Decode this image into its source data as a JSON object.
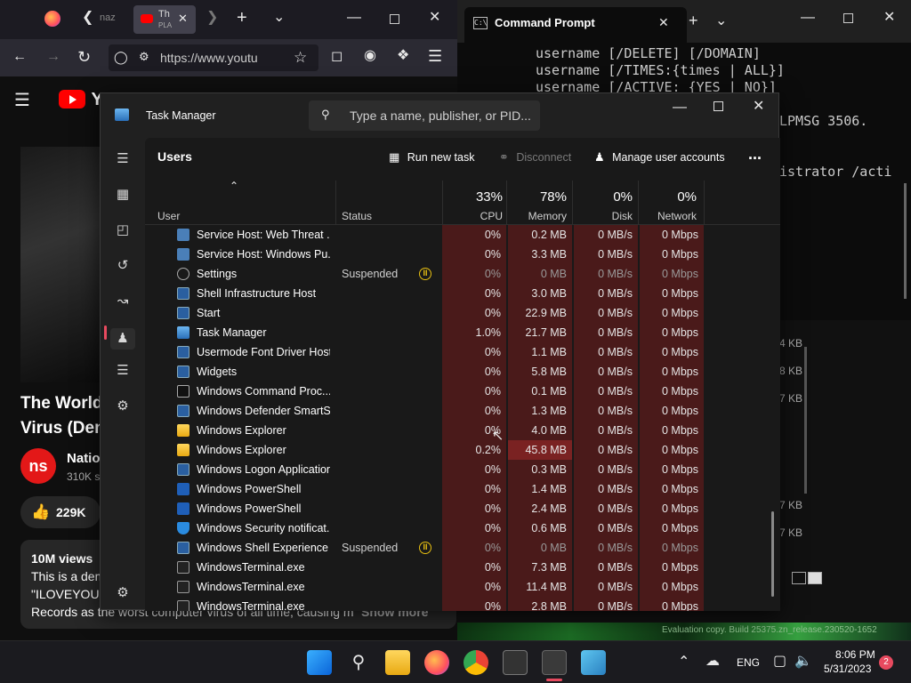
{
  "browser": {
    "tab_partial_1": "naz",
    "tab_partial_2": "Th",
    "tab_sub": "PLA",
    "url": "https://www.youtu",
    "yt_logo_partial": "Yo",
    "video_title_line1": "The World'",
    "video_title_line2": "Virus (Dem",
    "channel_partial": "Natio",
    "subs_partial": "310K s",
    "likes": "229K",
    "views": "10M views",
    "desc_line1": "This is a dem",
    "desc_line2": "\"ILOVEYOU\")",
    "desc_line3": "Records as the worst computer virus of all time, causing m",
    "show_more": "Show more"
  },
  "terminal": {
    "tab_title": "Command Prompt",
    "lines": [
      "username [/DELETE] [/DOMAIN]",
      "username [/TIMES:{times | ALL}]",
      "username [/ACTIVE: {YES | NO}]",
      "",
      "LPMSG 3506.",
      "",
      "istrator /acti"
    ]
  },
  "background_window": {
    "sizes": [
      "4 KB",
      "8 KB",
      "7 KB",
      "7 KB",
      "7 KB"
    ],
    "eval_text": "Evaluation copy. Build 25375.zn_release.230520-1652"
  },
  "taskmgr": {
    "title": "Task Manager",
    "search_placeholder": "Type a name, publisher, or PID...",
    "page_title": "Users",
    "run_new_task": "Run new task",
    "disconnect": "Disconnect",
    "manage_accounts": "Manage user accounts",
    "more": "...",
    "columns": {
      "user": "User",
      "status": "Status",
      "cpu_pct": "33%",
      "cpu": "CPU",
      "mem_pct": "78%",
      "memory": "Memory",
      "disk_pct": "0%",
      "disk": "Disk",
      "net_pct": "0%",
      "network": "Network"
    },
    "rows": [
      {
        "name": "Service Host: Web Threat ...",
        "status": "",
        "cpu": "0%",
        "mem": "0.2 MB",
        "disk": "0 MB/s",
        "net": "0 Mbps",
        "icon": "gear-box",
        "suspended": false
      },
      {
        "name": "Service Host: Windows Pu...",
        "status": "",
        "cpu": "0%",
        "mem": "3.3 MB",
        "disk": "0 MB/s",
        "net": "0 Mbps",
        "icon": "gear-box",
        "suspended": false
      },
      {
        "name": "Settings",
        "status": "Suspended",
        "cpu": "0%",
        "mem": "0 MB",
        "disk": "0 MB/s",
        "net": "0 Mbps",
        "icon": "gear",
        "suspended": true
      },
      {
        "name": "Shell Infrastructure Host",
        "status": "",
        "cpu": "0%",
        "mem": "3.0 MB",
        "disk": "0 MB/s",
        "net": "0 Mbps",
        "icon": "window",
        "suspended": false
      },
      {
        "name": "Start",
        "status": "",
        "cpu": "0%",
        "mem": "22.9 MB",
        "disk": "0 MB/s",
        "net": "0 Mbps",
        "icon": "window",
        "suspended": false
      },
      {
        "name": "Task Manager",
        "status": "",
        "cpu": "1.0%",
        "mem": "21.7 MB",
        "disk": "0 MB/s",
        "net": "0 Mbps",
        "icon": "taskmgr",
        "suspended": false
      },
      {
        "name": "Usermode Font Driver Host",
        "status": "",
        "cpu": "0%",
        "mem": "1.1 MB",
        "disk": "0 MB/s",
        "net": "0 Mbps",
        "icon": "window",
        "suspended": false
      },
      {
        "name": "Widgets",
        "status": "",
        "cpu": "0%",
        "mem": "5.8 MB",
        "disk": "0 MB/s",
        "net": "0 Mbps",
        "icon": "window",
        "suspended": false
      },
      {
        "name": "Windows Command Proc...",
        "status": "",
        "cpu": "0%",
        "mem": "0.1 MB",
        "disk": "0 MB/s",
        "net": "0 Mbps",
        "icon": "cmd",
        "suspended": false
      },
      {
        "name": "Windows Defender SmartS...",
        "status": "",
        "cpu": "0%",
        "mem": "1.3 MB",
        "disk": "0 MB/s",
        "net": "0 Mbps",
        "icon": "window",
        "suspended": false
      },
      {
        "name": "Windows Explorer",
        "status": "",
        "cpu": "0%",
        "mem": "4.0 MB",
        "disk": "0 MB/s",
        "net": "0 Mbps",
        "icon": "folder",
        "suspended": false
      },
      {
        "name": "Windows Explorer",
        "status": "",
        "cpu": "0.2%",
        "mem": "45.8 MB",
        "disk": "0 MB/s",
        "net": "0 Mbps",
        "icon": "folder",
        "suspended": false,
        "hot_mem": true
      },
      {
        "name": "Windows Logon Application",
        "status": "",
        "cpu": "0%",
        "mem": "0.3 MB",
        "disk": "0 MB/s",
        "net": "0 Mbps",
        "icon": "window",
        "suspended": false
      },
      {
        "name": "Windows PowerShell",
        "status": "",
        "cpu": "0%",
        "mem": "1.4 MB",
        "disk": "0 MB/s",
        "net": "0 Mbps",
        "icon": "ps",
        "suspended": false
      },
      {
        "name": "Windows PowerShell",
        "status": "",
        "cpu": "0%",
        "mem": "2.4 MB",
        "disk": "0 MB/s",
        "net": "0 Mbps",
        "icon": "ps",
        "suspended": false
      },
      {
        "name": "Windows Security notificat...",
        "status": "",
        "cpu": "0%",
        "mem": "0.6 MB",
        "disk": "0 MB/s",
        "net": "0 Mbps",
        "icon": "shield",
        "suspended": false
      },
      {
        "name": "Windows Shell Experience ...",
        "status": "Suspended",
        "cpu": "0%",
        "mem": "0 MB",
        "disk": "0 MB/s",
        "net": "0 Mbps",
        "icon": "window",
        "suspended": true
      },
      {
        "name": "WindowsTerminal.exe",
        "status": "",
        "cpu": "0%",
        "mem": "7.3 MB",
        "disk": "0 MB/s",
        "net": "0 Mbps",
        "icon": "term",
        "suspended": false
      },
      {
        "name": "WindowsTerminal.exe",
        "status": "",
        "cpu": "0%",
        "mem": "11.4 MB",
        "disk": "0 MB/s",
        "net": "0 Mbps",
        "icon": "term",
        "suspended": false
      },
      {
        "name": "WindowsTerminal.exe",
        "status": "",
        "cpu": "0%",
        "mem": "2.8 MB",
        "disk": "0 MB/s",
        "net": "0 Mbps",
        "icon": "term",
        "suspended": false
      }
    ]
  },
  "taskbar": {
    "lang": "ENG",
    "time": "8:06 PM",
    "date": "5/31/2023",
    "notif_count": "2"
  },
  "colors": {
    "heat_cell": "#4a1a1a",
    "heat_hot": "#7a2222",
    "suspended": "#e8c012",
    "accent": "#e84a5f"
  }
}
